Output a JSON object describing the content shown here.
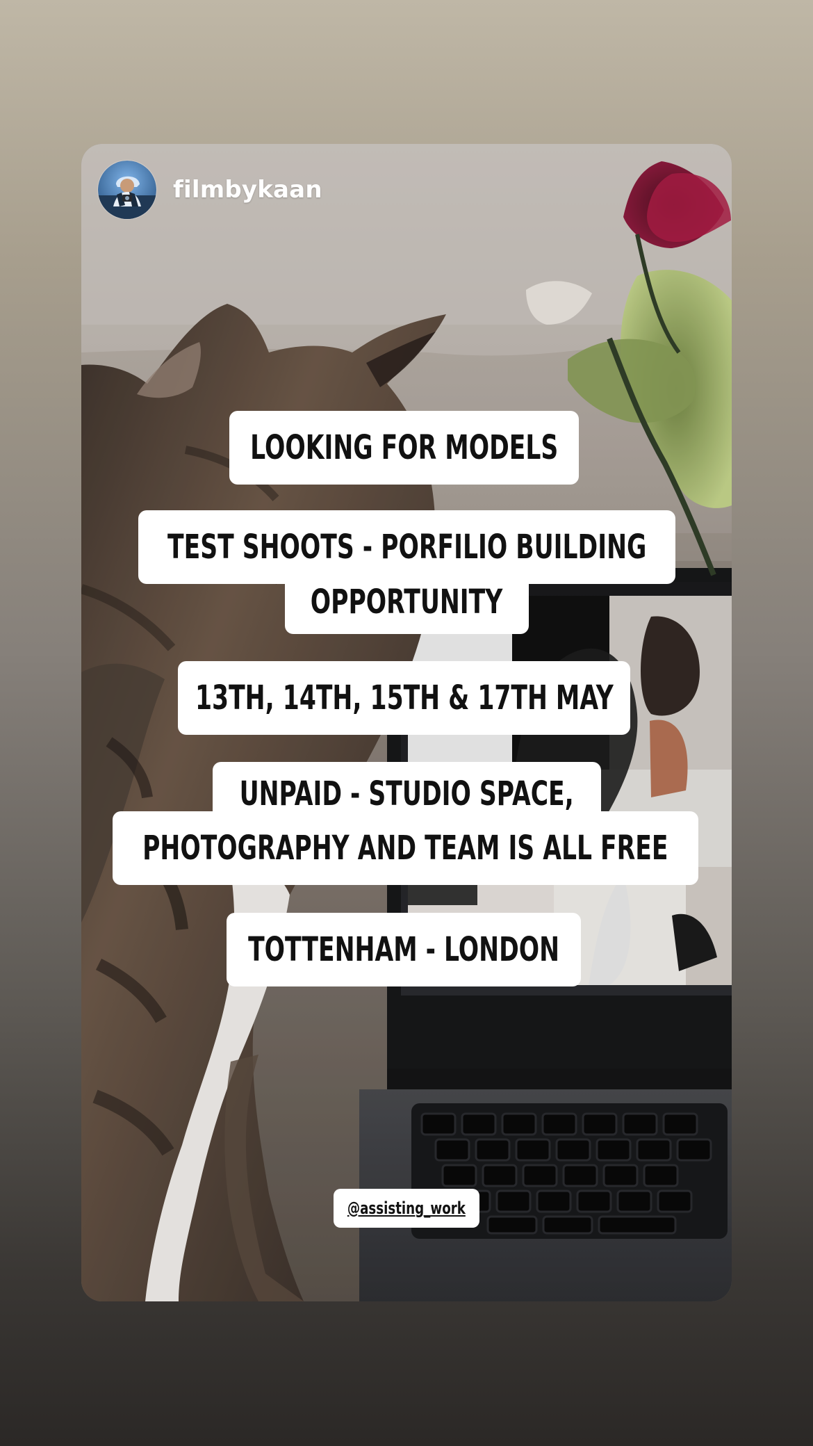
{
  "story": {
    "username": "filmbykaan",
    "captions": [
      "LOOKING FOR MODELS",
      "TEST SHOOTS - PORFILIO BUILDING",
      "OPPORTUNITY",
      "13TH, 14TH, 15TH & 17TH MAY",
      "UNPAID - STUDIO SPACE,",
      "PHOTOGRAPHY AND TEAM IS ALL FREE",
      "TOTTENHAM - LONDON"
    ],
    "mention": "@assisting_work"
  },
  "icons": {
    "avatar": "profile-avatar"
  }
}
